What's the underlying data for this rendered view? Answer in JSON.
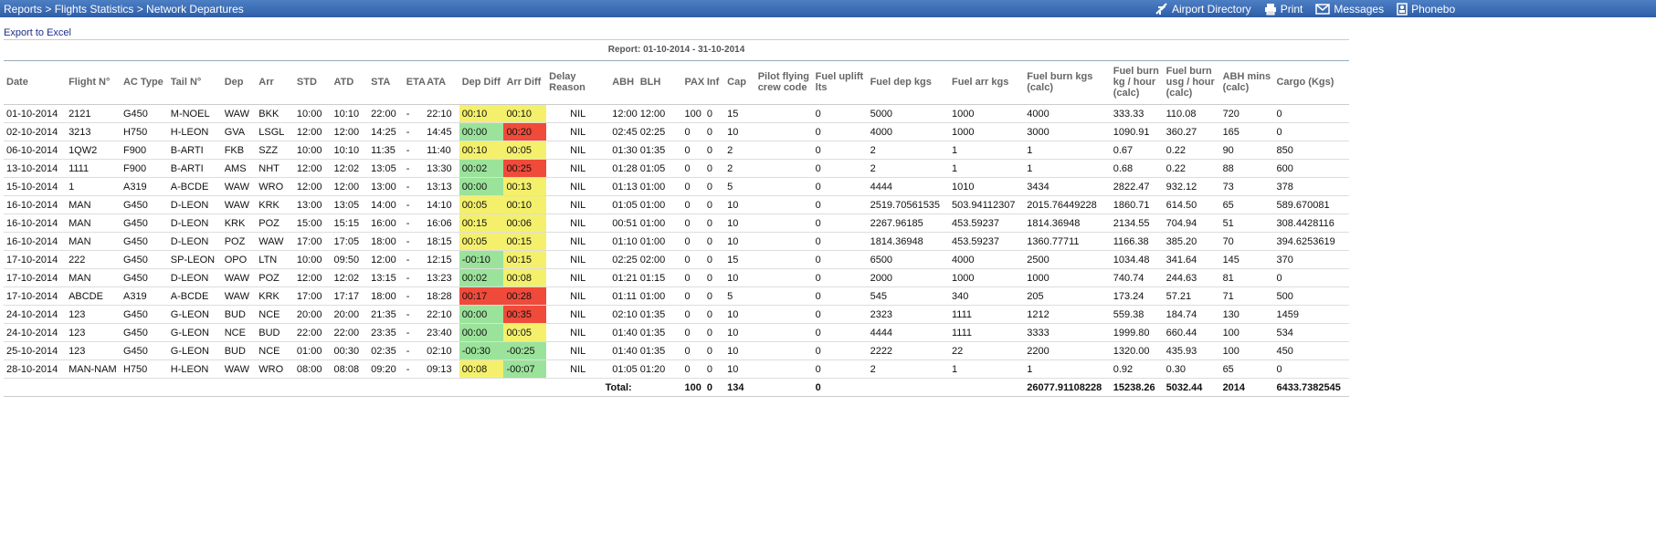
{
  "breadcrumb": "Reports > Flights Statistics > Network Departures",
  "top_actions": [
    {
      "label": "Airport Directory",
      "icon": "airplane-icon"
    },
    {
      "label": "Print",
      "icon": "printer-icon"
    },
    {
      "label": "Messages",
      "icon": "envelope-icon"
    },
    {
      "label": "Phonebo",
      "icon": "phonebook-icon"
    }
  ],
  "export_label": "Export to Excel",
  "report_title": "Report: 01-10-2014 - 31-10-2014",
  "colors": {
    "yellow": "#f4f06c",
    "green": "#9be39b",
    "red": "#ef4a3a",
    "header_blue": "#3a6cb5"
  },
  "columns": [
    "Date",
    "Flight N°",
    "AC Type",
    "Tail N°",
    "Dep",
    "Arr",
    "STD",
    "ATD",
    "STA",
    "ETA",
    "ATA",
    "Dep Diff",
    "Arr Diff",
    "Delay Reason",
    "ABH",
    "BLH",
    "PAX",
    "Inf",
    "Cap",
    "Pilot flying crew code",
    "Fuel uplift lts",
    "Fuel dep kgs",
    "Fuel arr kgs",
    "Fuel burn kgs (calc)",
    "Fuel burn kg / hour (calc)",
    "Fuel burn usg / hour (calc)",
    "ABH mins (calc)",
    "Cargo (Kgs)"
  ],
  "rows": [
    {
      "cells": [
        "01-10-2014",
        "2121",
        "G450",
        "M-NOEL",
        "WAW",
        "BKK",
        "10:00",
        "10:10",
        "22:00",
        "-",
        "22:10",
        "00:10",
        "00:10",
        "NIL",
        "12:00",
        "12:00",
        "100",
        "0",
        "15",
        "",
        "0",
        "5000",
        "1000",
        "4000",
        "333.33",
        "110.08",
        "720",
        "0"
      ],
      "dep_color": "y",
      "arr_color": "y"
    },
    {
      "cells": [
        "02-10-2014",
        "3213",
        "H750",
        "H-LEON",
        "GVA",
        "LSGL",
        "12:00",
        "12:00",
        "14:25",
        "-",
        "14:45",
        "00:00",
        "00:20",
        "NIL",
        "02:45",
        "02:25",
        "0",
        "0",
        "10",
        "",
        "0",
        "4000",
        "1000",
        "3000",
        "1090.91",
        "360.27",
        "165",
        "0"
      ],
      "dep_color": "g",
      "arr_color": "r"
    },
    {
      "cells": [
        "06-10-2014",
        "1QW2",
        "F900",
        "B-ARTI",
        "FKB",
        "SZZ",
        "10:00",
        "10:10",
        "11:35",
        "-",
        "11:40",
        "00:10",
        "00:05",
        "NIL",
        "01:30",
        "01:35",
        "0",
        "0",
        "2",
        "",
        "0",
        "2",
        "1",
        "1",
        "0.67",
        "0.22",
        "90",
        "850"
      ],
      "dep_color": "y",
      "arr_color": "y"
    },
    {
      "cells": [
        "13-10-2014",
        "1111",
        "F900",
        "B-ARTI",
        "AMS",
        "NHT",
        "12:00",
        "12:02",
        "13:05",
        "-",
        "13:30",
        "00:02",
        "00:25",
        "NIL",
        "01:28",
        "01:05",
        "0",
        "0",
        "2",
        "",
        "0",
        "2",
        "1",
        "1",
        "0.68",
        "0.22",
        "88",
        "600"
      ],
      "dep_color": "g",
      "arr_color": "r"
    },
    {
      "cells": [
        "15-10-2014",
        "1",
        "A319",
        "A-BCDE",
        "WAW",
        "WRO",
        "12:00",
        "12:00",
        "13:00",
        "-",
        "13:13",
        "00:00",
        "00:13",
        "NIL",
        "01:13",
        "01:00",
        "0",
        "0",
        "5",
        "",
        "0",
        "4444",
        "1010",
        "3434",
        "2822.47",
        "932.12",
        "73",
        "378"
      ],
      "dep_color": "g",
      "arr_color": "y"
    },
    {
      "cells": [
        "16-10-2014",
        "MAN",
        "G450",
        "D-LEON",
        "WAW",
        "KRK",
        "13:00",
        "13:05",
        "14:00",
        "-",
        "14:10",
        "00:05",
        "00:10",
        "NIL",
        "01:05",
        "01:00",
        "0",
        "0",
        "10",
        "",
        "0",
        "2519.70561535",
        "503.94112307",
        "2015.76449228",
        "1860.71",
        "614.50",
        "65",
        "589.670081"
      ],
      "dep_color": "y",
      "arr_color": "y"
    },
    {
      "cells": [
        "16-10-2014",
        "MAN",
        "G450",
        "D-LEON",
        "KRK",
        "POZ",
        "15:00",
        "15:15",
        "16:00",
        "-",
        "16:06",
        "00:15",
        "00:06",
        "NIL",
        "00:51",
        "01:00",
        "0",
        "0",
        "10",
        "",
        "0",
        "2267.96185",
        "453.59237",
        "1814.36948",
        "2134.55",
        "704.94",
        "51",
        "308.4428116"
      ],
      "dep_color": "y",
      "arr_color": "y"
    },
    {
      "cells": [
        "16-10-2014",
        "MAN",
        "G450",
        "D-LEON",
        "POZ",
        "WAW",
        "17:00",
        "17:05",
        "18:00",
        "-",
        "18:15",
        "00:05",
        "00:15",
        "NIL",
        "01:10",
        "01:00",
        "0",
        "0",
        "10",
        "",
        "0",
        "1814.36948",
        "453.59237",
        "1360.77711",
        "1166.38",
        "385.20",
        "70",
        "394.6253619"
      ],
      "dep_color": "y",
      "arr_color": "y"
    },
    {
      "cells": [
        "17-10-2014",
        "222",
        "G450",
        "SP-LEON",
        "OPO",
        "LTN",
        "10:00",
        "09:50",
        "12:00",
        "-",
        "12:15",
        "-00:10",
        "00:15",
        "NIL",
        "02:25",
        "02:00",
        "0",
        "0",
        "15",
        "",
        "0",
        "6500",
        "4000",
        "2500",
        "1034.48",
        "341.64",
        "145",
        "370"
      ],
      "dep_color": "g",
      "arr_color": "y"
    },
    {
      "cells": [
        "17-10-2014",
        "MAN",
        "G450",
        "D-LEON",
        "WAW",
        "POZ",
        "12:00",
        "12:02",
        "13:15",
        "-",
        "13:23",
        "00:02",
        "00:08",
        "NIL",
        "01:21",
        "01:15",
        "0",
        "0",
        "10",
        "",
        "0",
        "2000",
        "1000",
        "1000",
        "740.74",
        "244.63",
        "81",
        "0"
      ],
      "dep_color": "g",
      "arr_color": "y"
    },
    {
      "cells": [
        "17-10-2014",
        "ABCDE",
        "A319",
        "A-BCDE",
        "WAW",
        "KRK",
        "17:00",
        "17:17",
        "18:00",
        "-",
        "18:28",
        "00:17",
        "00:28",
        "NIL",
        "01:11",
        "01:00",
        "0",
        "0",
        "5",
        "",
        "0",
        "545",
        "340",
        "205",
        "173.24",
        "57.21",
        "71",
        "500"
      ],
      "dep_color": "r",
      "arr_color": "r"
    },
    {
      "cells": [
        "24-10-2014",
        "123",
        "G450",
        "G-LEON",
        "BUD",
        "NCE",
        "20:00",
        "20:00",
        "21:35",
        "-",
        "22:10",
        "00:00",
        "00:35",
        "NIL",
        "02:10",
        "01:35",
        "0",
        "0",
        "10",
        "",
        "0",
        "2323",
        "1111",
        "1212",
        "559.38",
        "184.74",
        "130",
        "1459"
      ],
      "dep_color": "g",
      "arr_color": "r"
    },
    {
      "cells": [
        "24-10-2014",
        "123",
        "G450",
        "G-LEON",
        "NCE",
        "BUD",
        "22:00",
        "22:00",
        "23:35",
        "-",
        "23:40",
        "00:00",
        "00:05",
        "NIL",
        "01:40",
        "01:35",
        "0",
        "0",
        "10",
        "",
        "0",
        "4444",
        "1111",
        "3333",
        "1999.80",
        "660.44",
        "100",
        "534"
      ],
      "dep_color": "g",
      "arr_color": "y"
    },
    {
      "cells": [
        "25-10-2014",
        "123",
        "G450",
        "G-LEON",
        "BUD",
        "NCE",
        "01:00",
        "00:30",
        "02:35",
        "-",
        "02:10",
        "-00:30",
        "-00:25",
        "NIL",
        "01:40",
        "01:35",
        "0",
        "0",
        "10",
        "",
        "0",
        "2222",
        "22",
        "2200",
        "1320.00",
        "435.93",
        "100",
        "450"
      ],
      "dep_color": "g",
      "arr_color": "g"
    },
    {
      "cells": [
        "28-10-2014",
        "MAN-NAM",
        "H750",
        "H-LEON",
        "WAW",
        "WRO",
        "08:00",
        "08:08",
        "09:20",
        "-",
        "09:13",
        "00:08",
        "-00:07",
        "NIL",
        "01:05",
        "01:20",
        "0",
        "0",
        "10",
        "",
        "0",
        "2",
        "1",
        "1",
        "0.92",
        "0.30",
        "65",
        "0"
      ],
      "dep_color": "y",
      "arr_color": "g"
    }
  ],
  "totals": {
    "label": "Total:",
    "pax": "100",
    "inf": "0",
    "cap": "134",
    "fuel_uplift": "0",
    "fuel_burn": "26077.91108228",
    "fuel_burn_kg_hour": "15238.26",
    "fuel_burn_usg_hour": "5032.44",
    "abh_mins": "2014",
    "cargo": "6433.7382545"
  }
}
